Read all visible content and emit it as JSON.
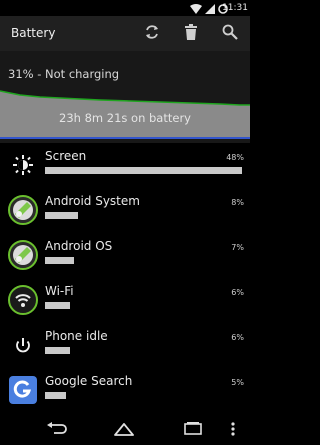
{
  "status_bar": {
    "time": "11:31",
    "icons": [
      "wifi-icon",
      "signal-icon",
      "battery-icon"
    ]
  },
  "action_bar": {
    "title": "Battery",
    "actions": [
      "refresh-icon",
      "delete-icon",
      "search-icon"
    ]
  },
  "graph": {
    "status": "31% - Not charging",
    "duration": "23h 8m 21s on battery",
    "colors": {
      "line": "#1fa51f",
      "fill": "#8a8a8a",
      "baseline": "#3355cc"
    }
  },
  "usage": [
    {
      "name": "Screen",
      "percent": "48%",
      "level": 0.48,
      "icon": "screen-brightness-icon"
    },
    {
      "name": "Android System",
      "percent": "8%",
      "level": 0.08,
      "icon": "android-system-icon"
    },
    {
      "name": "Android OS",
      "percent": "7%",
      "level": 0.07,
      "icon": "android-os-icon"
    },
    {
      "name": "Wi-Fi",
      "percent": "6%",
      "level": 0.06,
      "icon": "wifi-icon"
    },
    {
      "name": "Phone idle",
      "percent": "6%",
      "level": 0.06,
      "icon": "power-icon"
    },
    {
      "name": "Google Search",
      "percent": "5%",
      "level": 0.05,
      "icon": "google-search-icon"
    }
  ],
  "nav_bar": {
    "buttons": [
      "back-icon",
      "home-icon",
      "recents-icon",
      "menu-icon"
    ]
  }
}
